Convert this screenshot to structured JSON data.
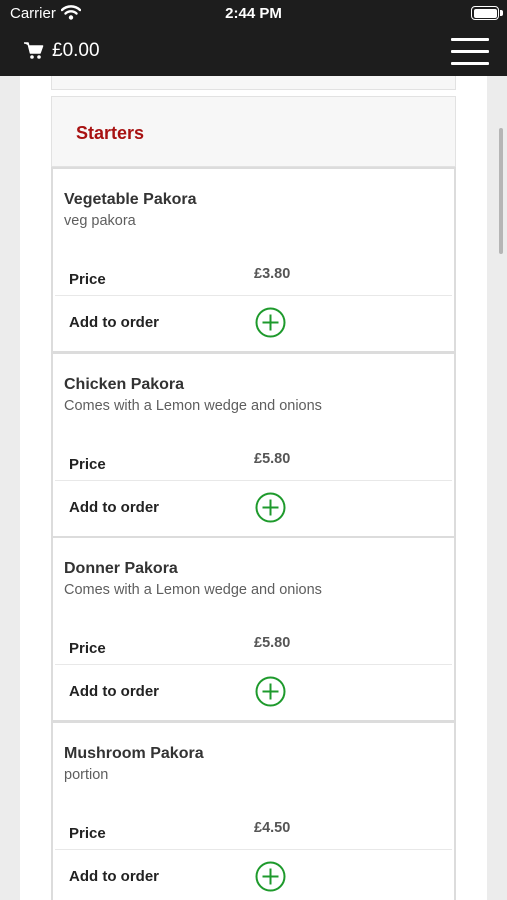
{
  "status_bar": {
    "carrier": "Carrier",
    "time": "2:44 PM"
  },
  "navbar": {
    "cart_total": "£0.00"
  },
  "section": {
    "title": "Starters"
  },
  "items": [
    {
      "name": "Vegetable Pakora",
      "description": "veg pakora",
      "price_label": "Price",
      "price": "£3.80",
      "add_label": "Add to order"
    },
    {
      "name": "Chicken Pakora",
      "description": "Comes with a Lemon wedge and onions",
      "price_label": "Price",
      "price": "£5.80",
      "add_label": "Add to order"
    },
    {
      "name": "Donner Pakora",
      "description": "Comes with a Lemon wedge and onions",
      "price_label": "Price",
      "price": "£5.80",
      "add_label": "Add to order"
    },
    {
      "name": "Mushroom Pakora",
      "description": "portion",
      "price_label": "Price",
      "price": "£4.50",
      "add_label": "Add to order"
    }
  ],
  "colors": {
    "header_bg": "#1d1d1d",
    "section_title": "#a81212",
    "add_icon": "#1e9a2c"
  },
  "icons": [
    "wifi-icon",
    "battery-icon",
    "cart-icon",
    "hamburger-menu-icon",
    "add-circle-icon"
  ]
}
